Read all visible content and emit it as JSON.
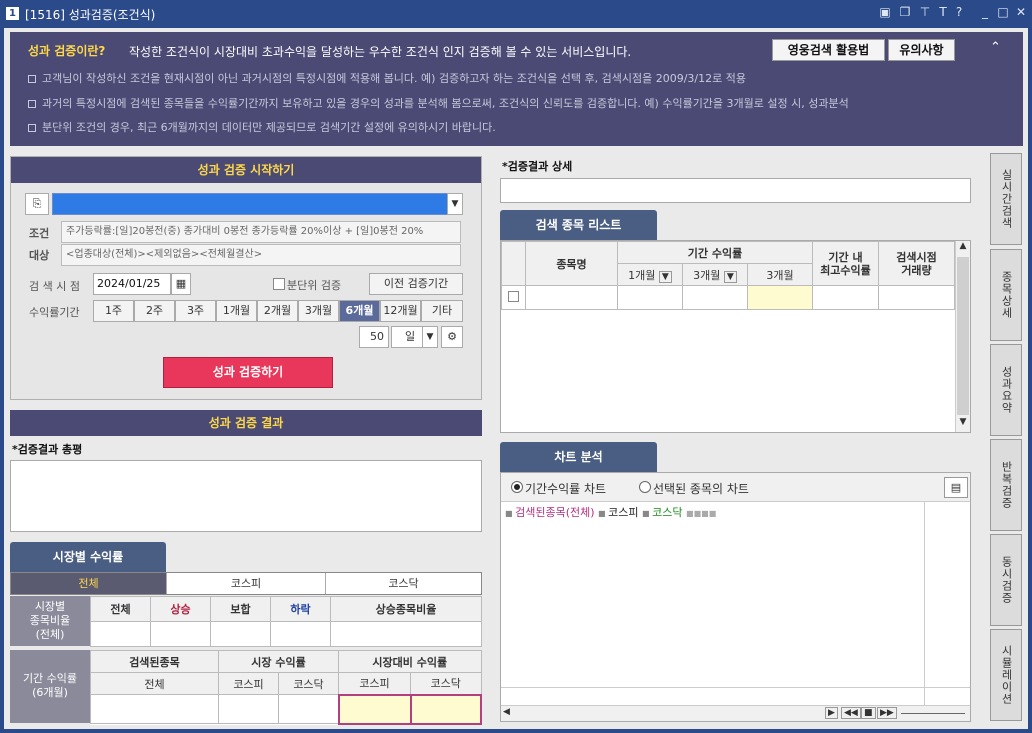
{
  "window": {
    "num": "1",
    "title": "[1516] 성과검증(조건식)",
    "icons": [
      "layout-icon",
      "restore-icon",
      "pin-icon",
      "font-icon",
      "help-icon",
      "minimize-icon",
      "maximize-icon",
      "close-icon"
    ]
  },
  "info": {
    "heading": "성과 검증이란?",
    "desc": "작성한 조건식이 시장대비 초과수익을 달성하는 우수한 조건식 인지 검증해 볼 수 있는 서비스입니다.",
    "lines": [
      "고객님이 작성하신 조건을 현재시점이 아닌 과거시점의 특정시점에 적용해 봅니다.   예) 검증하고자 하는 조건식을 선택 후, 검색시점을 2009/3/12로 적용",
      "과거의 특정시점에 검색된 종목들을 수익률기간까지 보유하고 있을 경우의 성과를 분석해 봄으로써, 조건식의 신뢰도를 검증합니다.   예) 수익률기간을 3개월로 설정 시, 성과분석",
      "분단위 조건의 경우, 최근 6개월까지의 데이터만 제공되므로 검색기간 설정에 유의하시기 바랍니다."
    ],
    "btn_usage": "영웅검색 활용법",
    "btn_notes": "유의사항"
  },
  "start": {
    "title": "성과 검증 시작하기",
    "cond_label": "조건",
    "target_label": "대상",
    "cond_text": "주가등락률:[일]20봉전(중) 종가대비 0봉전 종가등락률 20%이상 + [일]0봉전 20%",
    "target_text": "<업종대상(전체)><제외없음><전체월결산>",
    "search_time_label": "검 색 시 점",
    "date": "2024/01/25",
    "minute_label": "분단위 검증",
    "prev_btn": "이전 검증기간",
    "period_label": "수익률기간",
    "periods": [
      "1주",
      "2주",
      "3주",
      "1개월",
      "2개월",
      "3개월",
      "6개월",
      "12개월",
      "기타"
    ],
    "active_period": "6개월",
    "count": "50",
    "unit": "일",
    "run_btn": "성과 검증하기"
  },
  "result": {
    "title": "성과 검증 결과",
    "summary_label": "*검증결과 총평"
  },
  "market": {
    "tab": "시장별 수익률",
    "subtabs": [
      "전체",
      "코스피",
      "코스닥"
    ],
    "ratio_label": "시장별\n종목비율\n(전체)",
    "ratio_cols": [
      "전체",
      "상승",
      "보합",
      "하락",
      "상승종목비율"
    ],
    "period_label": "기간 수익률\n(6개월)",
    "grp1": "검색된종목",
    "grp2": "시장 수익률",
    "grp3": "시장대비 수익률",
    "sub1": "전체",
    "sub2": "코스피",
    "sub3": "코스닥",
    "sub4": "코스피",
    "sub5": "코스닥"
  },
  "detail": {
    "label": "*검증결과 상세"
  },
  "list": {
    "tab": "검색 종목 리스트",
    "col_name": "종목명",
    "col_period": "기간 수익률",
    "col_1m": "1개월",
    "col_3m": "3개월",
    "col_3m2": "3개월",
    "col_max": "기간 내\n최고수익률",
    "col_vol": "검색시점\n거래량"
  },
  "chart": {
    "tab": "차트 분석",
    "radio1": "기간수익률 차트",
    "radio2": "선택된 종목의 차트",
    "legend1": "검색된종목(전체)",
    "legend2": "코스피",
    "legend3": "코스닥",
    "legend1_color": "#b03080",
    "legend2_color": "#222222",
    "legend3_color": "#1a8a1a"
  },
  "side": [
    "실시간검색",
    "종목상세",
    "성과요약",
    "반복검증",
    "동시검증",
    "시뮬레이션"
  ]
}
